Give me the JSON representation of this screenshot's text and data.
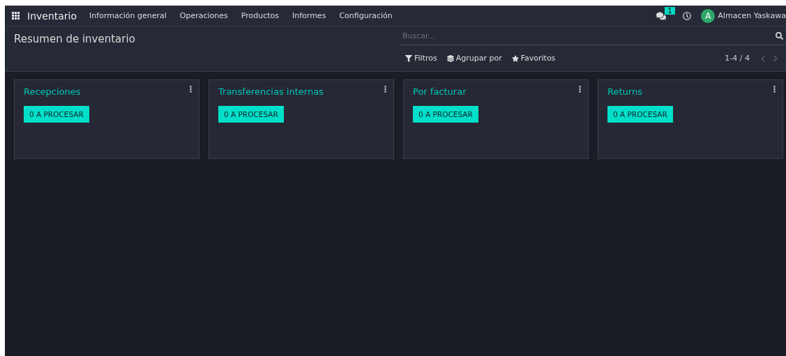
{
  "navbar": {
    "app_name": "Inventario",
    "menu": [
      "Información general",
      "Operaciones",
      "Productos",
      "Informes",
      "Configuración"
    ],
    "messages_badge": "1",
    "user": {
      "initial": "A",
      "name": "Almacen Yaskawa"
    }
  },
  "control_panel": {
    "title": "Resumen de inventario",
    "search": {
      "placeholder": "Buscar..."
    },
    "filters": [
      "Filtros",
      "Agrupar por",
      "Favoritos"
    ],
    "pager": "1-4 / 4"
  },
  "cards": [
    {
      "title": "Recepciones",
      "button": "0 A PROCESAR"
    },
    {
      "title": "Transferencias internas",
      "button": "0 A PROCESAR"
    },
    {
      "title": "Por facturar",
      "button": "0 A PROCESAR"
    },
    {
      "title": "Returns",
      "button": "0 A PROCESAR"
    }
  ]
}
